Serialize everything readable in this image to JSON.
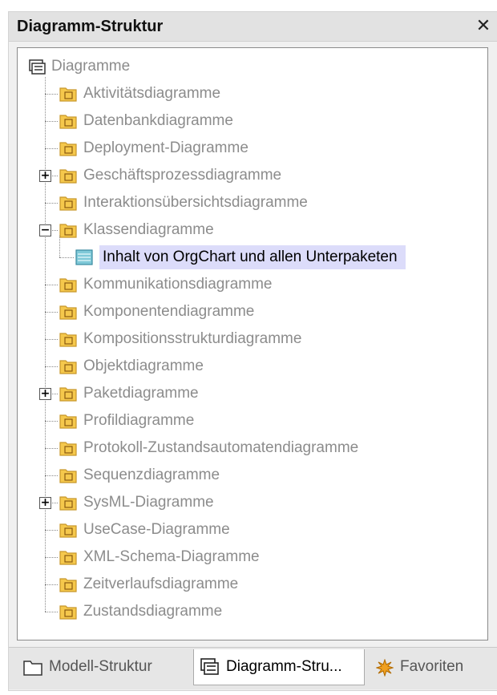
{
  "panel": {
    "title": "Diagramm-Struktur",
    "close_glyph": "✕"
  },
  "tree": {
    "root_label": "Diagramme",
    "nodes": [
      {
        "label": "Aktivitätsdiagramme",
        "icon": "activity-diagram-folder-icon"
      },
      {
        "label": "Datenbankdiagramme",
        "icon": "database-diagram-folder-icon"
      },
      {
        "label": "Deployment-Diagramme",
        "icon": "deployment-diagram-folder-icon"
      },
      {
        "label": "Geschäftsprozessdiagramme",
        "icon": "business-process-diagram-folder-icon",
        "toggle": "+"
      },
      {
        "label": "Interaktionsübersichtsdiagramme",
        "icon": "interaction-overview-diagram-folder-icon"
      },
      {
        "label": "Klassendiagramme",
        "icon": "class-diagram-folder-icon",
        "toggle": "−"
      },
      {
        "label": "Inhalt von OrgChart und allen Unterpaketen",
        "icon": "class-diagram-icon",
        "child": true,
        "selected": true
      },
      {
        "label": "Kommunikationsdiagramme",
        "icon": "communication-diagram-folder-icon"
      },
      {
        "label": "Komponentendiagramme",
        "icon": "component-diagram-folder-icon"
      },
      {
        "label": "Kompositionsstrukturdiagramme",
        "icon": "composite-structure-diagram-folder-icon"
      },
      {
        "label": "Objektdiagramme",
        "icon": "object-diagram-folder-icon"
      },
      {
        "label": "Paketdiagramme",
        "icon": "package-diagram-folder-icon",
        "toggle": "+"
      },
      {
        "label": "Profildiagramme",
        "icon": "profile-diagram-folder-icon"
      },
      {
        "label": "Protokoll-Zustandsautomatendiagramme",
        "icon": "protocol-state-machine-diagram-folder-icon"
      },
      {
        "label": "Sequenzdiagramme",
        "icon": "sequence-diagram-folder-icon"
      },
      {
        "label": "SysML-Diagramme",
        "icon": "sysml-diagram-folder-icon",
        "toggle": "+"
      },
      {
        "label": "UseCase-Diagramme",
        "icon": "use-case-diagram-folder-icon"
      },
      {
        "label": "XML-Schema-Diagramme",
        "icon": "xml-schema-diagram-folder-icon"
      },
      {
        "label": "Zeitverlaufsdiagramme",
        "icon": "timing-diagram-folder-icon"
      },
      {
        "label": "Zustandsdiagramme",
        "icon": "state-diagram-folder-icon"
      }
    ]
  },
  "tabs": [
    {
      "label": "Modell-Struktur",
      "icon": "model-tree-icon",
      "active": false
    },
    {
      "label": "Diagramm-Stru...",
      "icon": "diagram-tree-icon",
      "active": true
    },
    {
      "label": "Favoriten",
      "icon": "favorites-icon",
      "active": false
    }
  ],
  "colors": {
    "folder_fill": "#f5c84c",
    "folder_stroke": "#c8962a",
    "selection_bg": "#dcdcfa",
    "inactive_text": "#8c8c8c"
  }
}
